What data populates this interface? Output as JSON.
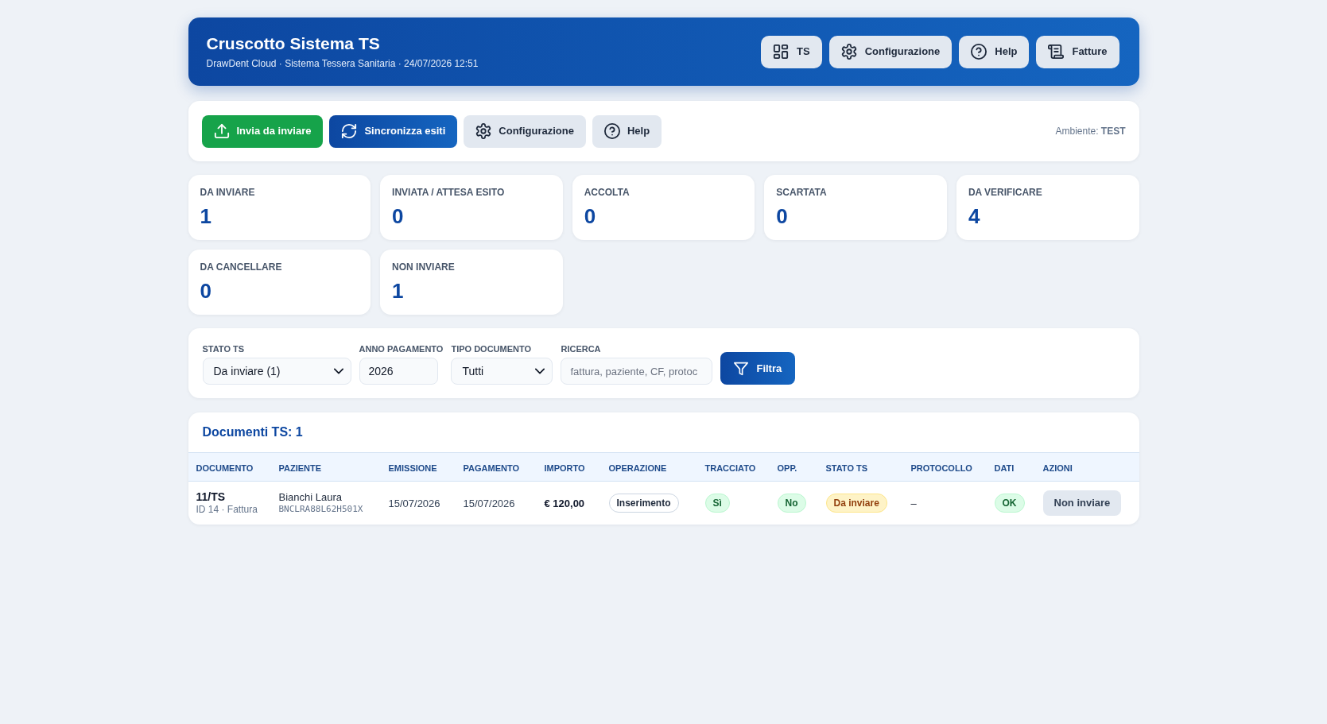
{
  "header": {
    "title": "Cruscotto Sistema TS",
    "subtitle": "DrawDent Cloud · Sistema Tessera Sanitaria · 24/07/2026 12:51",
    "buttons": [
      {
        "label": "TS"
      },
      {
        "label": "Configurazione"
      },
      {
        "label": "Help"
      },
      {
        "label": "Fatture"
      }
    ]
  },
  "toolbar": {
    "buttons": [
      {
        "label": "Invia da inviare",
        "kind": "success"
      },
      {
        "label": "Sincronizza esiti",
        "kind": "primary"
      },
      {
        "label": "Configurazione",
        "kind": "secondary"
      },
      {
        "label": "Help",
        "kind": "secondary"
      }
    ],
    "environment": "Ambiente: **TEST**"
  },
  "stats": [
    {
      "label": "DA INVIARE",
      "value": "1"
    },
    {
      "label": "INVIATA / ATTESA ESITO",
      "value": "0"
    },
    {
      "label": "ACCOLTA",
      "value": "0"
    },
    {
      "label": "SCARTATA",
      "value": "0"
    },
    {
      "label": "DA VERIFICARE",
      "value": "4"
    },
    {
      "label": "DA CANCELLARE",
      "value": "0"
    },
    {
      "label": "NON INVIARE",
      "value": "1"
    }
  ],
  "filters": {
    "fields": [
      {
        "label": "STATO TS",
        "kind": "select",
        "value": "Da inviare (1)"
      },
      {
        "label": "ANNO PAGAMENTO",
        "kind": "input",
        "value": "2026"
      },
      {
        "label": "TIPO DOCUMENTO",
        "kind": "select",
        "value": "Tutti"
      },
      {
        "label": "RICERCA",
        "kind": "input",
        "placeholder": "fattura, paziente, CF, protoc"
      }
    ],
    "button": {
      "label": "Filtra"
    }
  },
  "table": {
    "title": "Documenti TS: 1",
    "columns": [
      "DOCUMENTO",
      "PAZIENTE",
      "EMISSIONE",
      "PAGAMENTO",
      "IMPORTO",
      "OPERAZIONE",
      "TRACCIATO",
      "OPP.",
      "STATO TS",
      "PROTOCOLLO",
      "DATI",
      "AZIONI"
    ],
    "rows": [
      {
        "documento": {
          "number": "11/TS",
          "detail": "ID 14 · Fattura"
        },
        "paziente": {
          "name": "Bianchi Laura",
          "tax_code": "BNCLRA88L62H501X"
        },
        "emissione": "15/07/2026",
        "pagamento": "15/07/2026",
        "importo": "€ 120,00",
        "operazione": {
          "text": "Inserimento",
          "kind": "neutral"
        },
        "tracciato": {
          "text": "Sì",
          "kind": "success"
        },
        "opp": {
          "text": "No",
          "kind": "success"
        },
        "stato_ts": {
          "text": "Da inviare",
          "kind": "warning"
        },
        "protocollo": "–",
        "dati": {
          "text": "OK",
          "kind": "success"
        },
        "azioni": [
          {
            "label": "Non inviare"
          }
        ]
      }
    ]
  }
}
